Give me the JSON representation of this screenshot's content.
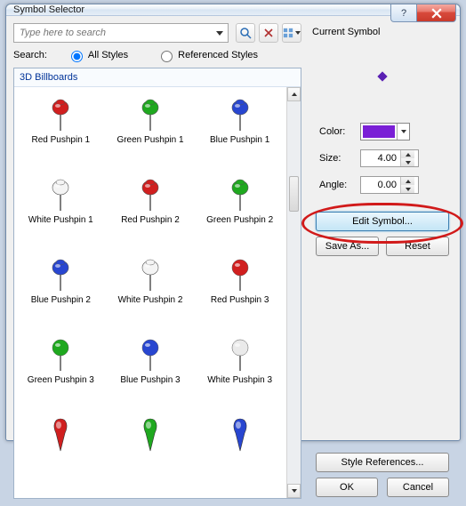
{
  "window": {
    "title": "Symbol Selector"
  },
  "search": {
    "placeholder": "Type here to search",
    "label": "Search:",
    "all": "All Styles",
    "ref": "Referenced Styles"
  },
  "gallery": {
    "group": "3D Billboards",
    "items": [
      {
        "label": "Red Pushpin 1",
        "shape": "pushpin",
        "color": "#d01f1f"
      },
      {
        "label": "Green Pushpin 1",
        "shape": "pushpin",
        "color": "#1fa81f"
      },
      {
        "label": "Blue Pushpin 1",
        "shape": "pushpin",
        "color": "#2846d0"
      },
      {
        "label": "White Pushpin 1",
        "shape": "pushpin",
        "color": "#f4f4f4"
      },
      {
        "label": "Red Pushpin 2",
        "shape": "pushpin",
        "color": "#d01f1f"
      },
      {
        "label": "Green Pushpin 2",
        "shape": "pushpin",
        "color": "#1fa81f"
      },
      {
        "label": "Blue Pushpin 2",
        "shape": "pushpin",
        "color": "#2846d0"
      },
      {
        "label": "White Pushpin 2",
        "shape": "pushpin",
        "color": "#f4f4f4"
      },
      {
        "label": "Red Pushpin 3",
        "shape": "sphere",
        "color": "#d01f1f"
      },
      {
        "label": "Green Pushpin 3",
        "shape": "sphere",
        "color": "#1fa81f"
      },
      {
        "label": "Blue Pushpin 3",
        "shape": "sphere",
        "color": "#2846d0"
      },
      {
        "label": "White Pushpin 3",
        "shape": "sphere",
        "color": "#eaeaea"
      },
      {
        "label": "",
        "shape": "teardrop",
        "color": "#d01f1f"
      },
      {
        "label": "",
        "shape": "teardrop",
        "color": "#1fa81f"
      },
      {
        "label": "",
        "shape": "teardrop",
        "color": "#2846d0"
      }
    ]
  },
  "right": {
    "current": "Current Symbol",
    "color_label": "Color:",
    "color_value": "#7a1fd6",
    "size_label": "Size:",
    "size_value": "4.00",
    "angle_label": "Angle:",
    "angle_value": "0.00",
    "edit": "Edit Symbol...",
    "save_as": "Save As...",
    "reset": "Reset",
    "style_refs": "Style References...",
    "ok": "OK",
    "cancel": "Cancel"
  }
}
